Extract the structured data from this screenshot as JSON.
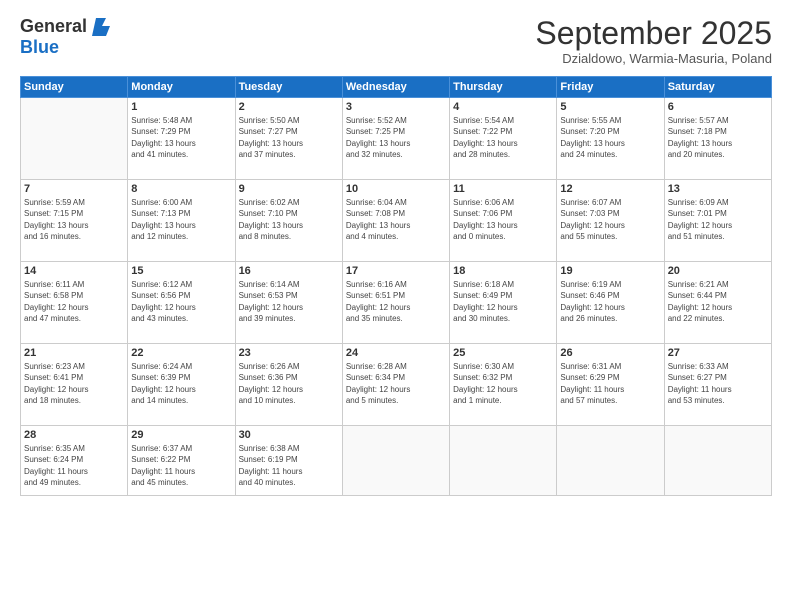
{
  "header": {
    "logo_general": "General",
    "logo_blue": "Blue",
    "month_title": "September 2025",
    "subtitle": "Dzialdowo, Warmia-Masuria, Poland"
  },
  "days_of_week": [
    "Sunday",
    "Monday",
    "Tuesday",
    "Wednesday",
    "Thursday",
    "Friday",
    "Saturday"
  ],
  "weeks": [
    [
      {
        "day": "",
        "info": ""
      },
      {
        "day": "1",
        "info": "Sunrise: 5:48 AM\nSunset: 7:29 PM\nDaylight: 13 hours\nand 41 minutes."
      },
      {
        "day": "2",
        "info": "Sunrise: 5:50 AM\nSunset: 7:27 PM\nDaylight: 13 hours\nand 37 minutes."
      },
      {
        "day": "3",
        "info": "Sunrise: 5:52 AM\nSunset: 7:25 PM\nDaylight: 13 hours\nand 32 minutes."
      },
      {
        "day": "4",
        "info": "Sunrise: 5:54 AM\nSunset: 7:22 PM\nDaylight: 13 hours\nand 28 minutes."
      },
      {
        "day": "5",
        "info": "Sunrise: 5:55 AM\nSunset: 7:20 PM\nDaylight: 13 hours\nand 24 minutes."
      },
      {
        "day": "6",
        "info": "Sunrise: 5:57 AM\nSunset: 7:18 PM\nDaylight: 13 hours\nand 20 minutes."
      }
    ],
    [
      {
        "day": "7",
        "info": "Sunrise: 5:59 AM\nSunset: 7:15 PM\nDaylight: 13 hours\nand 16 minutes."
      },
      {
        "day": "8",
        "info": "Sunrise: 6:00 AM\nSunset: 7:13 PM\nDaylight: 13 hours\nand 12 minutes."
      },
      {
        "day": "9",
        "info": "Sunrise: 6:02 AM\nSunset: 7:10 PM\nDaylight: 13 hours\nand 8 minutes."
      },
      {
        "day": "10",
        "info": "Sunrise: 6:04 AM\nSunset: 7:08 PM\nDaylight: 13 hours\nand 4 minutes."
      },
      {
        "day": "11",
        "info": "Sunrise: 6:06 AM\nSunset: 7:06 PM\nDaylight: 13 hours\nand 0 minutes."
      },
      {
        "day": "12",
        "info": "Sunrise: 6:07 AM\nSunset: 7:03 PM\nDaylight: 12 hours\nand 55 minutes."
      },
      {
        "day": "13",
        "info": "Sunrise: 6:09 AM\nSunset: 7:01 PM\nDaylight: 12 hours\nand 51 minutes."
      }
    ],
    [
      {
        "day": "14",
        "info": "Sunrise: 6:11 AM\nSunset: 6:58 PM\nDaylight: 12 hours\nand 47 minutes."
      },
      {
        "day": "15",
        "info": "Sunrise: 6:12 AM\nSunset: 6:56 PM\nDaylight: 12 hours\nand 43 minutes."
      },
      {
        "day": "16",
        "info": "Sunrise: 6:14 AM\nSunset: 6:53 PM\nDaylight: 12 hours\nand 39 minutes."
      },
      {
        "day": "17",
        "info": "Sunrise: 6:16 AM\nSunset: 6:51 PM\nDaylight: 12 hours\nand 35 minutes."
      },
      {
        "day": "18",
        "info": "Sunrise: 6:18 AM\nSunset: 6:49 PM\nDaylight: 12 hours\nand 30 minutes."
      },
      {
        "day": "19",
        "info": "Sunrise: 6:19 AM\nSunset: 6:46 PM\nDaylight: 12 hours\nand 26 minutes."
      },
      {
        "day": "20",
        "info": "Sunrise: 6:21 AM\nSunset: 6:44 PM\nDaylight: 12 hours\nand 22 minutes."
      }
    ],
    [
      {
        "day": "21",
        "info": "Sunrise: 6:23 AM\nSunset: 6:41 PM\nDaylight: 12 hours\nand 18 minutes."
      },
      {
        "day": "22",
        "info": "Sunrise: 6:24 AM\nSunset: 6:39 PM\nDaylight: 12 hours\nand 14 minutes."
      },
      {
        "day": "23",
        "info": "Sunrise: 6:26 AM\nSunset: 6:36 PM\nDaylight: 12 hours\nand 10 minutes."
      },
      {
        "day": "24",
        "info": "Sunrise: 6:28 AM\nSunset: 6:34 PM\nDaylight: 12 hours\nand 5 minutes."
      },
      {
        "day": "25",
        "info": "Sunrise: 6:30 AM\nSunset: 6:32 PM\nDaylight: 12 hours\nand 1 minute."
      },
      {
        "day": "26",
        "info": "Sunrise: 6:31 AM\nSunset: 6:29 PM\nDaylight: 11 hours\nand 57 minutes."
      },
      {
        "day": "27",
        "info": "Sunrise: 6:33 AM\nSunset: 6:27 PM\nDaylight: 11 hours\nand 53 minutes."
      }
    ],
    [
      {
        "day": "28",
        "info": "Sunrise: 6:35 AM\nSunset: 6:24 PM\nDaylight: 11 hours\nand 49 minutes."
      },
      {
        "day": "29",
        "info": "Sunrise: 6:37 AM\nSunset: 6:22 PM\nDaylight: 11 hours\nand 45 minutes."
      },
      {
        "day": "30",
        "info": "Sunrise: 6:38 AM\nSunset: 6:19 PM\nDaylight: 11 hours\nand 40 minutes."
      },
      {
        "day": "",
        "info": ""
      },
      {
        "day": "",
        "info": ""
      },
      {
        "day": "",
        "info": ""
      },
      {
        "day": "",
        "info": ""
      }
    ]
  ]
}
